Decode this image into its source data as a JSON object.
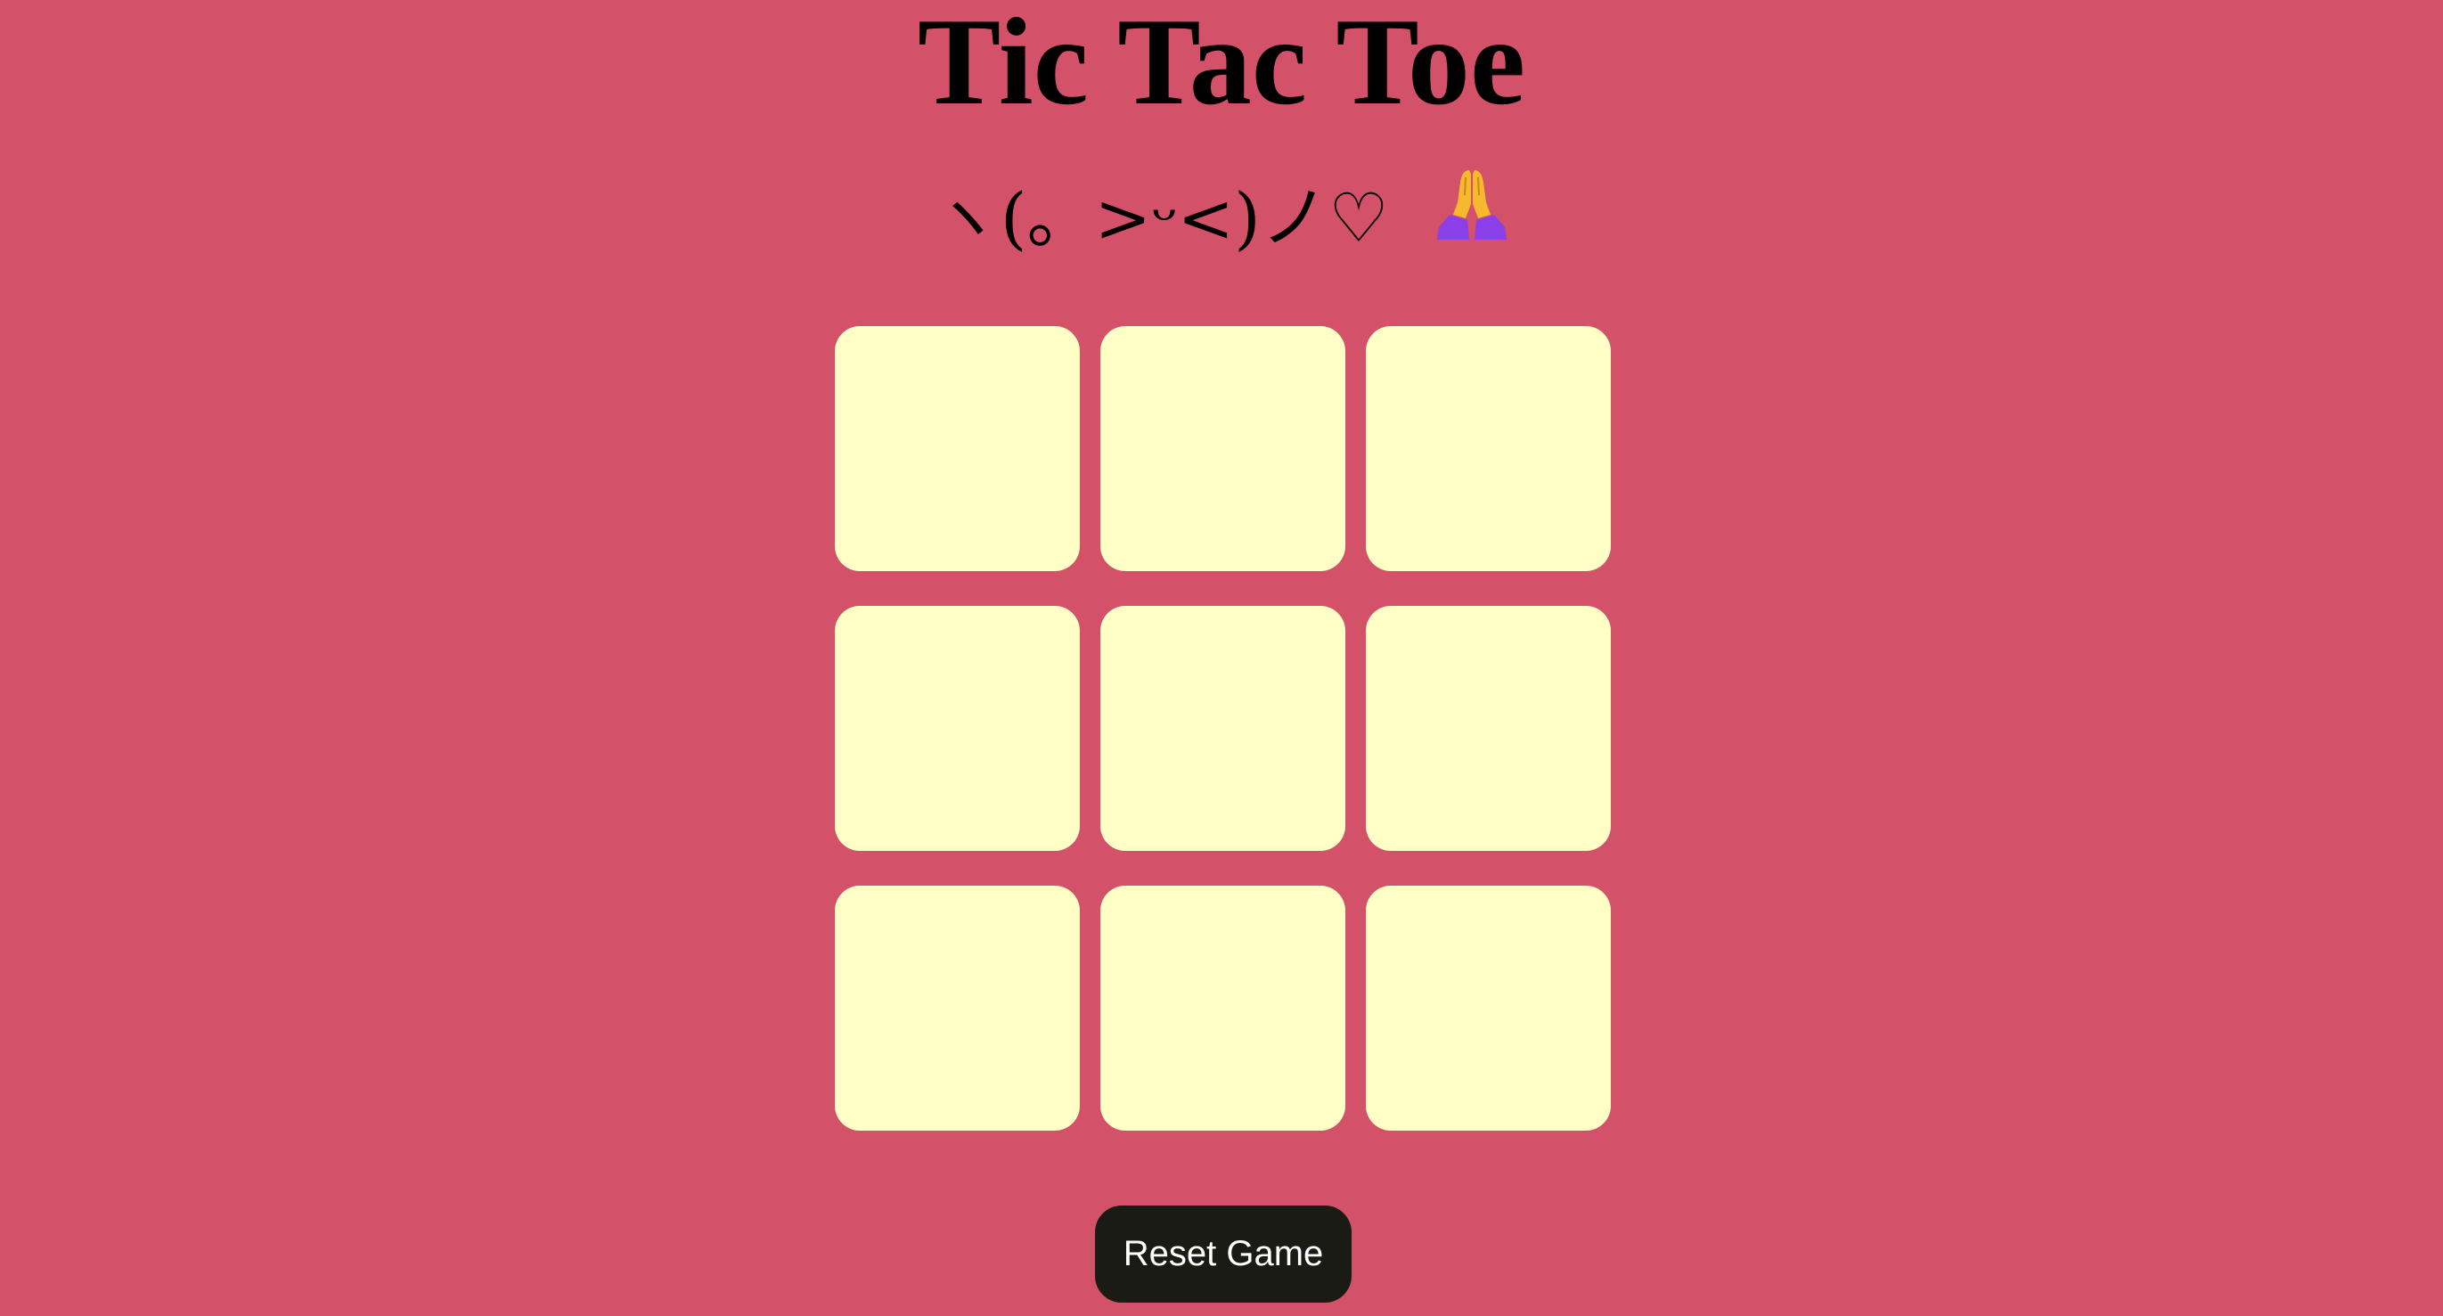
{
  "title": "Tic Tac Toe",
  "subtitle": "ヽ(。>ᵕ<)ノ♡",
  "subtitle_emoji": "folded-hands-emoji",
  "board": {
    "cells": [
      "",
      "",
      "",
      "",
      "",
      "",
      "",
      "",
      ""
    ]
  },
  "reset_label": "Reset Game",
  "colors": {
    "background": "#d35269",
    "cell": "#ffffc6",
    "button": "#1b1b16",
    "button_text": "#ffffff",
    "emoji_skin": "#f5b82e",
    "emoji_sleeve": "#8b3fe8"
  }
}
